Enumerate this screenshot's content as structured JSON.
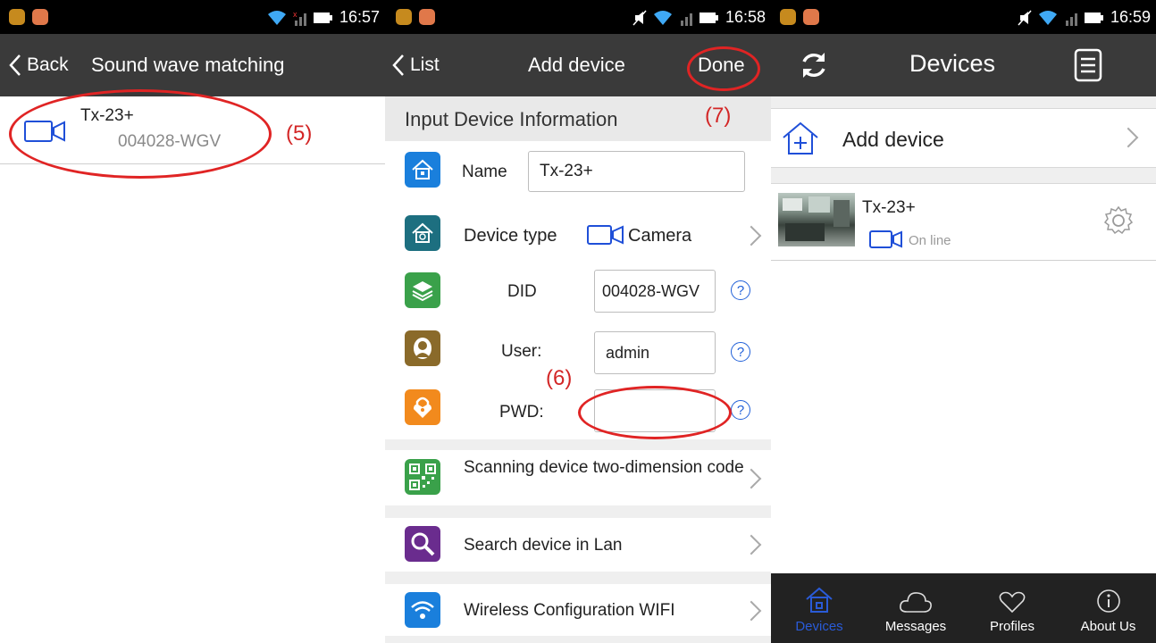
{
  "panel1": {
    "status": {
      "time": "16:57"
    },
    "nav": {
      "back_label": "Back",
      "title": "Sound wave matching"
    },
    "device": {
      "name": "Tx-23+",
      "did": "004028-WGV"
    },
    "annotation": "(5)"
  },
  "panel2": {
    "status": {
      "time": "16:58"
    },
    "nav": {
      "back_label": "List",
      "title": "Add device",
      "done_label": "Done"
    },
    "section_title": "Input Device Information",
    "annotation_done": "(7)",
    "annotation_pwd": "(6)",
    "fields": {
      "name_label": "Name",
      "name_value": "Tx-23+",
      "type_label": "Device type",
      "type_value": "Camera",
      "did_label": "DID",
      "did_value": "004028-WGV",
      "user_label": "User:",
      "user_value": "admin",
      "pwd_label": "PWD:",
      "pwd_value": ""
    },
    "actions": {
      "scan_label": "Scanning device two-dimension code",
      "search_label": "Search device in Lan",
      "wifi_label": "Wireless Configuration WIFI"
    },
    "help_glyph": "?"
  },
  "panel3": {
    "status": {
      "time": "16:59"
    },
    "nav": {
      "title": "Devices"
    },
    "add_device_label": "Add device",
    "device": {
      "name": "Tx-23+",
      "status": "On line"
    },
    "tabs": [
      {
        "label": "Devices",
        "icon": "home-icon"
      },
      {
        "label": "Messages",
        "icon": "cloud-icon"
      },
      {
        "label": "Profiles",
        "icon": "heart-icon"
      },
      {
        "label": "About Us",
        "icon": "info-icon"
      }
    ]
  },
  "colors": {
    "statusbar": "#000000",
    "navbar": "#3a3a3a",
    "annotation": "#d32626",
    "tab_active": "#2a5bd7",
    "icon_blue": "#1a7fdc",
    "icon_teal": "#1d6f80",
    "icon_green": "#3aa14a",
    "icon_brown": "#8a6a2a",
    "icon_orange": "#f28a1d",
    "icon_purple": "#6a2c8e"
  }
}
